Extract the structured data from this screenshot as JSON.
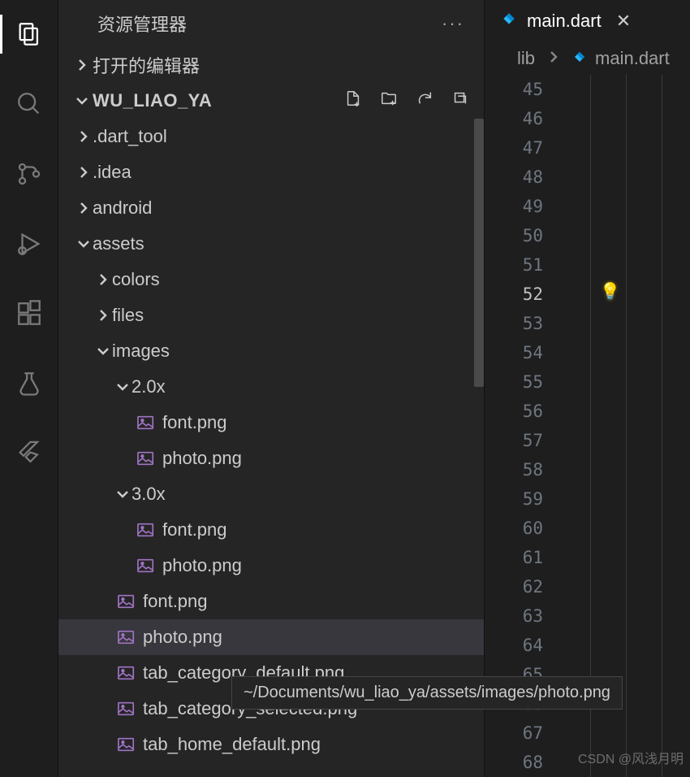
{
  "activity": {
    "items": [
      {
        "id": "explorer",
        "active": true
      },
      {
        "id": "search"
      },
      {
        "id": "source-control"
      },
      {
        "id": "run"
      },
      {
        "id": "extensions"
      },
      {
        "id": "testing"
      },
      {
        "id": "flutter"
      }
    ]
  },
  "sidebar": {
    "title": "资源管理器",
    "open_editors": "打开的编辑器",
    "workspace": "WU_LIAO_YA",
    "tree": [
      {
        "label": ".dart_tool",
        "type": "folder",
        "open": false,
        "depth": 1
      },
      {
        "label": ".idea",
        "type": "folder",
        "open": false,
        "depth": 1
      },
      {
        "label": "android",
        "type": "folder",
        "open": false,
        "depth": 1
      },
      {
        "label": "assets",
        "type": "folder",
        "open": true,
        "depth": 1
      },
      {
        "label": "colors",
        "type": "folder",
        "open": false,
        "depth": 2
      },
      {
        "label": "files",
        "type": "folder",
        "open": false,
        "depth": 2
      },
      {
        "label": "images",
        "type": "folder",
        "open": true,
        "depth": 2
      },
      {
        "label": "2.0x",
        "type": "folder",
        "open": true,
        "depth": 3
      },
      {
        "label": "font.png",
        "type": "file-img",
        "depth": 4
      },
      {
        "label": "photo.png",
        "type": "file-img",
        "depth": 4
      },
      {
        "label": "3.0x",
        "type": "folder",
        "open": true,
        "depth": 3
      },
      {
        "label": "font.png",
        "type": "file-img",
        "depth": 4
      },
      {
        "label": "photo.png",
        "type": "file-img",
        "depth": 4
      },
      {
        "label": "font.png",
        "type": "file-img",
        "depth": 3
      },
      {
        "label": "photo.png",
        "type": "file-img",
        "depth": 3,
        "selected": true
      },
      {
        "label": "tab_category_default.png",
        "type": "file-img",
        "depth": 3
      },
      {
        "label": "tab_category_selected.png",
        "type": "file-img",
        "depth": 3
      },
      {
        "label": "tab_home_default.png",
        "type": "file-img",
        "depth": 3
      }
    ]
  },
  "editor": {
    "tab_label": "main.dart",
    "breadcrumb": {
      "folder": "lib",
      "file": "main.dart"
    },
    "lines_start": 45,
    "lines_end": 68,
    "current_line": 52
  },
  "tooltip": "~/Documents/wu_liao_ya/assets/images/photo.png",
  "watermark": "CSDN @风浅月明"
}
